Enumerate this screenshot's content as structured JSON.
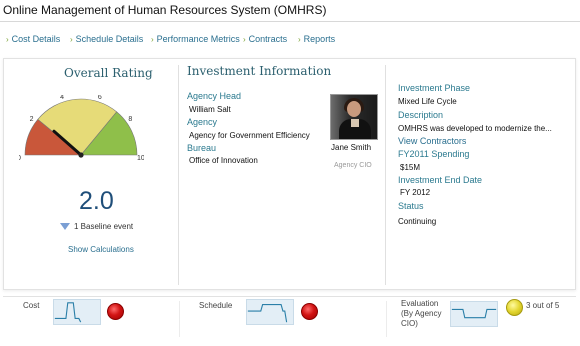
{
  "app": {
    "title": "Online Management of Human Resources System (OMHRS)"
  },
  "nav": [
    {
      "label": "Cost Details"
    },
    {
      "label": "Schedule Details"
    },
    {
      "label": "Performance Metrics"
    },
    {
      "label": "Contracts"
    },
    {
      "label": "Reports"
    }
  ],
  "overall": {
    "title": "Overall Rating",
    "rating": "2.0",
    "rating_value": 2.0,
    "gauge_max": 10,
    "gauge_ticks": [
      "0",
      "2",
      "4",
      "6",
      "8",
      "10"
    ],
    "baseline_text": "1 Baseline event",
    "show_calc": "Show Calculations",
    "colors": {
      "red": "#c9573a",
      "yellow": "#e6db78",
      "green": "#8fbf4a",
      "needle": "#111111"
    }
  },
  "investment": {
    "title": "Investment Information",
    "agency_head_label": "Agency Head",
    "agency_head": "William Salt",
    "agency_label": "Agency",
    "agency": "Agency for Government Efficiency",
    "bureau_label": "Bureau",
    "bureau": "Office of Innovation",
    "cio_name": "Jane Smith",
    "cio_role": "Agency CIO",
    "phase_label": "Investment Phase",
    "phase": "Mixed Life Cycle",
    "description_label": "Description",
    "description": "OMHRS was developed to modernize the...",
    "contractors_link": "View Contractors",
    "spending_label": "FY2011 Spending",
    "spending": "$15M",
    "end_date_label": "Investment End Date",
    "end_date": "FY 2012",
    "status_label": "Status",
    "status": "Continuing"
  },
  "bottom": {
    "cost_label": "Cost",
    "schedule_label": "Schedule",
    "evaluation_label_1": "Evaluation",
    "evaluation_label_2": "(By Agency",
    "evaluation_label_3": "CIO)",
    "evaluation_score": "3 out of 5",
    "colors": {
      "red": "#d21414",
      "yellow": "#e3d630",
      "sparkline": "#2a7fa8"
    }
  }
}
